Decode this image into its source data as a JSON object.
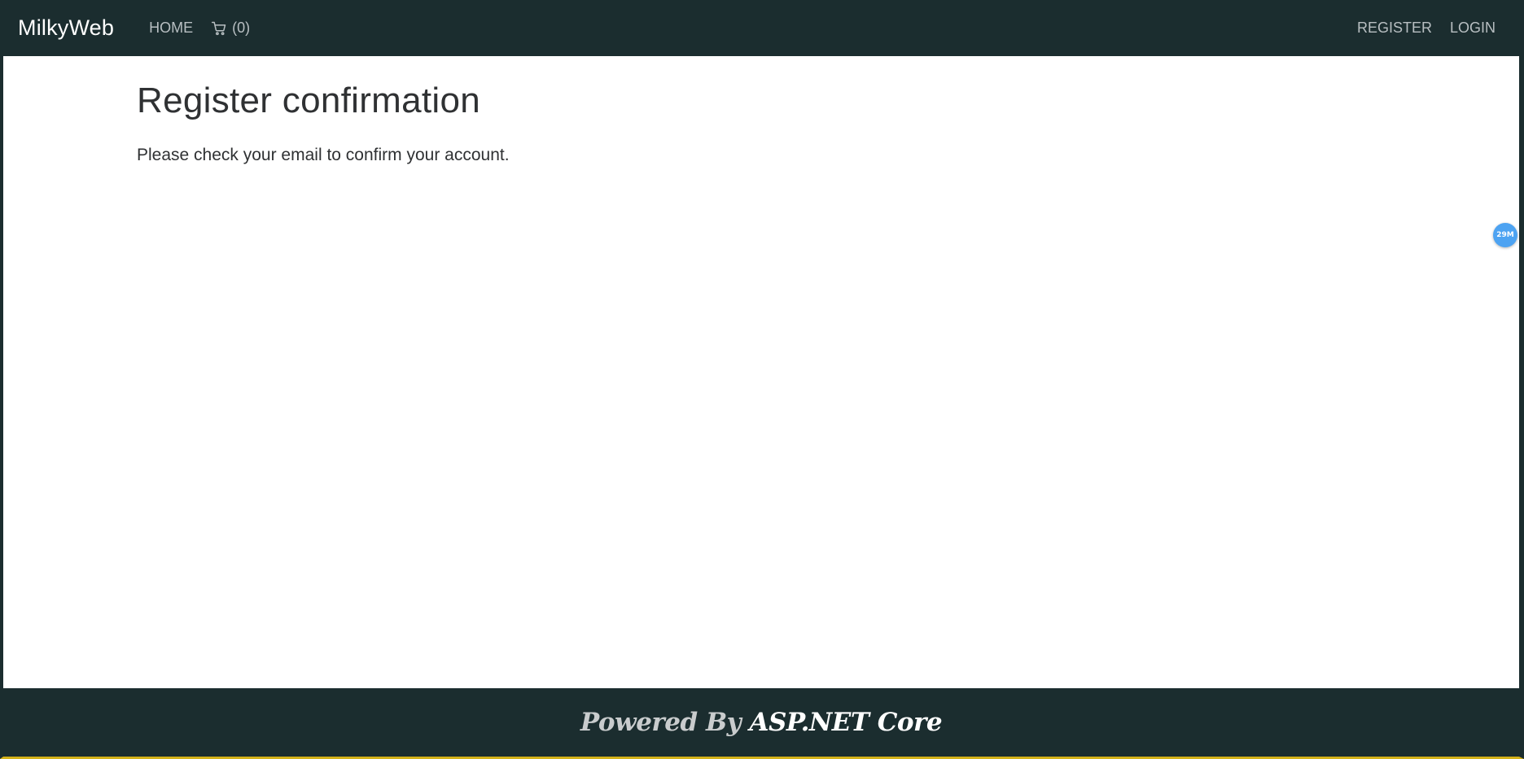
{
  "navbar": {
    "brand": "MilkyWeb",
    "home_label": "HOME",
    "cart_label": "(0)",
    "register_label": "REGISTER",
    "login_label": "LOGIN"
  },
  "main": {
    "title": "Register confirmation",
    "message": "Please check your email to confirm your account."
  },
  "perf_badge": {
    "label": "29M"
  },
  "footer": {
    "prefix": "Powered By",
    "tech": "ASP.NET Core"
  },
  "colors": {
    "nav_background": "#1b2d2f",
    "nav_link": "#b8bfc2",
    "badge": "#4da3f2",
    "frame_accent": "#d4b21a"
  }
}
